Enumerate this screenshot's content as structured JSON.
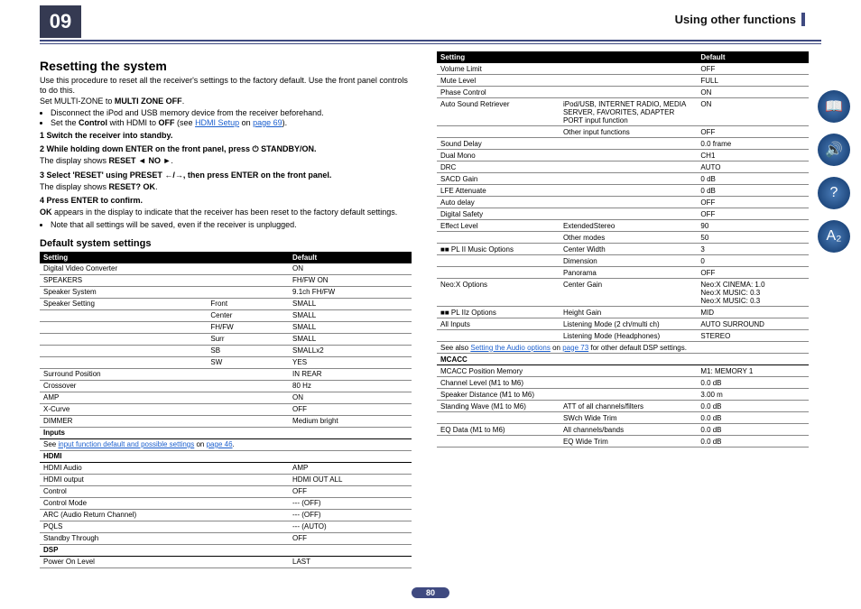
{
  "chapter": "09",
  "chapterTitle": "Using other functions",
  "page": "80",
  "h1": "Resetting the system",
  "intro": [
    "Use this procedure to reset all the receiver's settings to the factory default. Use the front panel controls to do this.",
    "Set MULTI-ZONE to "
  ],
  "introBold": "MULTI ZONE OFF",
  "bul1": "Disconnect the iPod and USB memory device from the receiver beforehand.",
  "bul2a": "Set the ",
  "bul2b": "Control",
  " bul2c": " with HDMI to ",
  "bul2d": "OFF",
  "bul2e": " (see ",
  "bul2link": "HDMI Setup",
  "bul2f": " on ",
  "bul2pg": "page 69",
  "bul2g": ").",
  "step1": "1    Switch the receiver into standby.",
  "step2": "2    While holding down ENTER on the front panel, press ⏻ STANDBY/ON.",
  "step2sub": [
    "The display shows ",
    "RESET ◄ NO ►",
    "."
  ],
  "step3": "3    Select 'RESET' using PRESET ←/→, then press ENTER on the front panel.",
  "step3sub": [
    "The display shows ",
    "RESET? OK",
    "."
  ],
  "step4": "4    Press ENTER to confirm.",
  "ok": [
    "OK",
    " appears in the display to indicate that the receiver has been reset to the factory default settings."
  ],
  "note": "Note that all settings will be saved, even if the receiver is unplugged.",
  "h2": "Default system settings",
  "th1": "Setting",
  "th2": "Default",
  "tableL": [
    {
      "c": [
        [
          "Digital Video Converter",
          "",
          ""
        ],
        [
          "",
          "",
          "ON"
        ]
      ]
    },
    {
      "c": [
        [
          "SPEAKERS",
          "",
          ""
        ],
        [
          "",
          "",
          "FH/FW ON"
        ]
      ]
    },
    {
      "c": [
        [
          "Speaker System",
          "",
          ""
        ],
        [
          "",
          "",
          "9.1ch FH/FW"
        ]
      ]
    },
    {
      "c": [
        [
          "Speaker Setting",
          "Front",
          ""
        ],
        [
          "",
          "",
          "SMALL"
        ]
      ],
      "first": true
    },
    {
      "c": [
        [
          "",
          "Center",
          ""
        ],
        [
          "",
          "",
          "SMALL"
        ]
      ]
    },
    {
      "c": [
        [
          "",
          "FH/FW",
          ""
        ],
        [
          "",
          "",
          "SMALL"
        ]
      ]
    },
    {
      "c": [
        [
          "",
          "Surr",
          ""
        ],
        [
          "",
          "",
          "SMALL"
        ]
      ]
    },
    {
      "c": [
        [
          "",
          "SB",
          ""
        ],
        [
          "",
          "",
          "SMALLx2"
        ]
      ]
    },
    {
      "c": [
        [
          "",
          "SW",
          ""
        ],
        [
          "",
          "",
          "YES"
        ]
      ]
    },
    {
      "c": [
        [
          "Surround Position",
          "",
          ""
        ],
        [
          "",
          "",
          "IN REAR"
        ]
      ]
    },
    {
      "c": [
        [
          "Crossover",
          "",
          ""
        ],
        [
          "",
          "",
          "80 Hz"
        ]
      ]
    },
    {
      "c": [
        [
          "AMP",
          "",
          ""
        ],
        [
          "",
          "",
          "ON"
        ]
      ]
    },
    {
      "c": [
        [
          "X-Curve",
          "",
          ""
        ],
        [
          "",
          "",
          "OFF"
        ]
      ]
    },
    {
      "c": [
        [
          "DIMMER",
          "",
          ""
        ],
        [
          "",
          "",
          "Medium bright"
        ]
      ]
    }
  ],
  "sectInputs": "Inputs",
  "inputsLine": [
    "See ",
    "input function default and possible settings",
    " on ",
    "page 46",
    "."
  ],
  "sectHDMI": "HDMI",
  "tableHDMI": [
    [
      "HDMI Audio",
      "",
      "AMP"
    ],
    [
      "HDMI output",
      "",
      "HDMI OUT ALL"
    ],
    [
      "Control",
      "",
      "OFF"
    ],
    [
      "Control Mode",
      "",
      "--- (OFF)"
    ],
    [
      "ARC (Audio Return Channel)",
      "",
      "--- (OFF)"
    ],
    [
      "PQLS",
      "",
      "--- (AUTO)"
    ],
    [
      "Standby Through",
      "",
      "OFF"
    ]
  ],
  "sectDSP": "DSP",
  "tableDSP": [
    [
      "Power On Level",
      "",
      "LAST"
    ]
  ],
  "tableR": [
    [
      "Volume Limit",
      "",
      "OFF"
    ],
    [
      "Mute Level",
      "",
      "FULL"
    ],
    [
      "Phase Control",
      "",
      "ON"
    ],
    [
      "Auto Sound Retriever",
      "iPod/USB, INTERNET RADIO, MEDIA SERVER, FAVORITES, ADAPTER PORT input function",
      "ON"
    ],
    [
      "",
      "Other input functions",
      "OFF"
    ],
    [
      "Sound Delay",
      "",
      "0.0 frame"
    ],
    [
      "Dual Mono",
      "",
      "CH1"
    ],
    [
      "DRC",
      "",
      "AUTO"
    ],
    [
      "SACD Gain",
      "",
      "0 dB"
    ],
    [
      "LFE Attenuate",
      "",
      "0 dB"
    ],
    [
      "Auto delay",
      "",
      "OFF"
    ],
    [
      "Digital Safety",
      "",
      "OFF"
    ],
    [
      "Effect Level",
      "ExtendedStereo",
      "90"
    ],
    [
      "",
      "Other modes",
      "50"
    ],
    [
      "■■ PL II Music Options",
      "Center Width",
      "3"
    ],
    [
      "",
      "Dimension",
      "0"
    ],
    [
      "",
      "Panorama",
      "OFF"
    ],
    [
      "Neo:X Options",
      "Center Gain",
      "Neo:X CINEMA: 1.0\nNeo:X MUSIC: 0.3\nNeo:X MUSIC: 0.3"
    ],
    [
      "■■ PL IIz Options",
      "Height Gain",
      "MID"
    ],
    [
      "All Inputs",
      "Listening Mode (2 ch/multi ch)",
      "AUTO SURROUND"
    ],
    [
      "",
      "Listening Mode (Headphones)",
      "STEREO"
    ]
  ],
  "seeAlso": [
    "See also ",
    "Setting the Audio options",
    " on ",
    "page 73",
    " for other default DSP settings."
  ],
  "sectMCACC": "MCACC",
  "tableMC": [
    [
      "MCACC Position Memory",
      "",
      "M1: MEMORY 1"
    ],
    [
      "Channel Level (M1 to M6)",
      "",
      "0.0 dB"
    ],
    [
      "Speaker Distance (M1 to M6)",
      "",
      "3.00 m"
    ],
    [
      "Standing Wave (M1 to M6)",
      "ATT of all channels/filters",
      "0.0 dB"
    ],
    [
      "",
      "SWch Wide Trim",
      "0.0 dB"
    ],
    [
      "EQ Data (M1 to M6)",
      "All channels/bands",
      "0.0 dB"
    ],
    [
      "",
      "EQ Wide Trim",
      "0.0 dB"
    ]
  ]
}
